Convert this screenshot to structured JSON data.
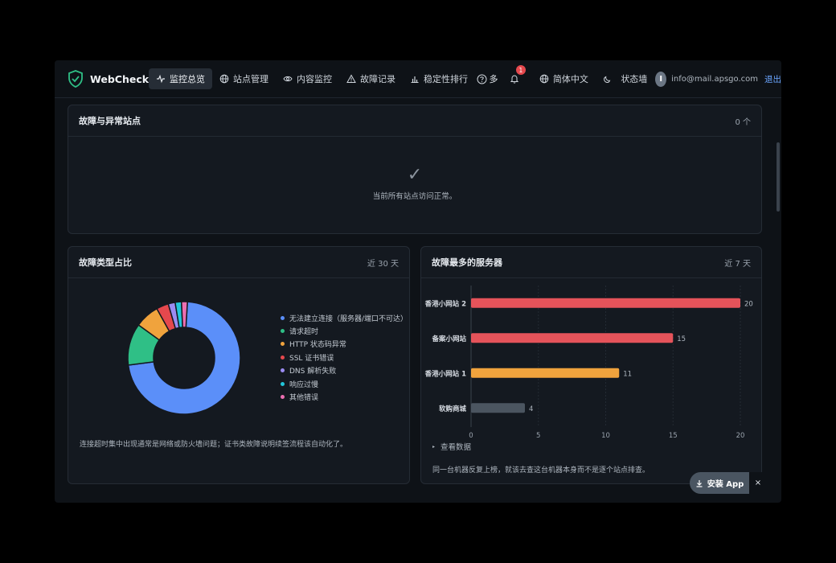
{
  "brand": {
    "name": "WebCheck"
  },
  "nav": {
    "items": [
      {
        "label": "监控总览",
        "icon": "activity-icon",
        "active": true
      },
      {
        "label": "站点管理",
        "icon": "globe-icon",
        "active": false
      },
      {
        "label": "内容监控",
        "icon": "eye-icon",
        "active": false
      },
      {
        "label": "故障记录",
        "icon": "warning-icon",
        "active": false
      },
      {
        "label": "稳定性排行",
        "icon": "bar-chart-icon",
        "active": false
      }
    ],
    "more_label": "多",
    "notification_count": "1",
    "language_label": "简体中文",
    "status_wall_label": "状态墙",
    "avatar_initial": "I",
    "user_email": "info@mail.apsgo.com",
    "logout_label": "退出"
  },
  "faults": {
    "title": "故障与异常站点",
    "count": "0 个",
    "check_glyph": "✓",
    "empty_text": "当前所有站点访问正常。"
  },
  "fault_types": {
    "title": "故障类型占比",
    "period": "近 30 天",
    "legend": [
      {
        "label": "无法建立连接（服务器/端口不可达）",
        "color": "#5b8ff9"
      },
      {
        "label": "请求超时",
        "color": "#2fbf86"
      },
      {
        "label": "HTTP 状态码异常",
        "color": "#f0a33d"
      },
      {
        "label": "SSL 证书错误",
        "color": "#e5484d"
      },
      {
        "label": "DNS 解析失败",
        "color": "#9b8cf2"
      },
      {
        "label": "响应过慢",
        "color": "#22c6d9"
      },
      {
        "label": "其他错误",
        "color": "#ec6fb1"
      }
    ],
    "note": "连接超时集中出现通常是网络或防火墙问题；证书类故障说明续签流程该自动化了。"
  },
  "top_servers": {
    "title": "故障最多的服务器",
    "period": "近 7 天",
    "toggle_label": "查看数据",
    "note": "同一台机器反复上榜，就该去查这台机器本身而不是逐个站点排查。"
  },
  "install": {
    "label": "安装 App",
    "close": "×"
  },
  "chart_data": [
    {
      "type": "pie",
      "title": "故障类型占比",
      "categories": [
        "无法建立连接（服务器/端口不可达）",
        "请求超时",
        "HTTP 状态码异常",
        "SSL 证书错误",
        "DNS 解析失败",
        "响应过慢",
        "其他错误"
      ],
      "values": [
        72,
        12,
        7,
        3.5,
        2,
        1.8,
        1.7
      ],
      "colors": [
        "#5b8ff9",
        "#2fbf86",
        "#f0a33d",
        "#e5484d",
        "#9b8cf2",
        "#22c6d9",
        "#ec6fb1"
      ],
      "donut": true,
      "legend_position": "right"
    },
    {
      "type": "bar",
      "orientation": "horizontal",
      "title": "故障最多的服务器",
      "categories": [
        "香港小网站 2",
        "备案小网站",
        "香港小网站 1",
        "软购商城"
      ],
      "values": [
        20,
        15,
        11,
        4
      ],
      "colors": [
        "#e5535a",
        "#e5535a",
        "#f0a33d",
        "#4b5560"
      ],
      "xlim": [
        0,
        20
      ],
      "xticks": [
        0,
        5,
        10,
        15,
        20
      ],
      "grid": true
    }
  ]
}
